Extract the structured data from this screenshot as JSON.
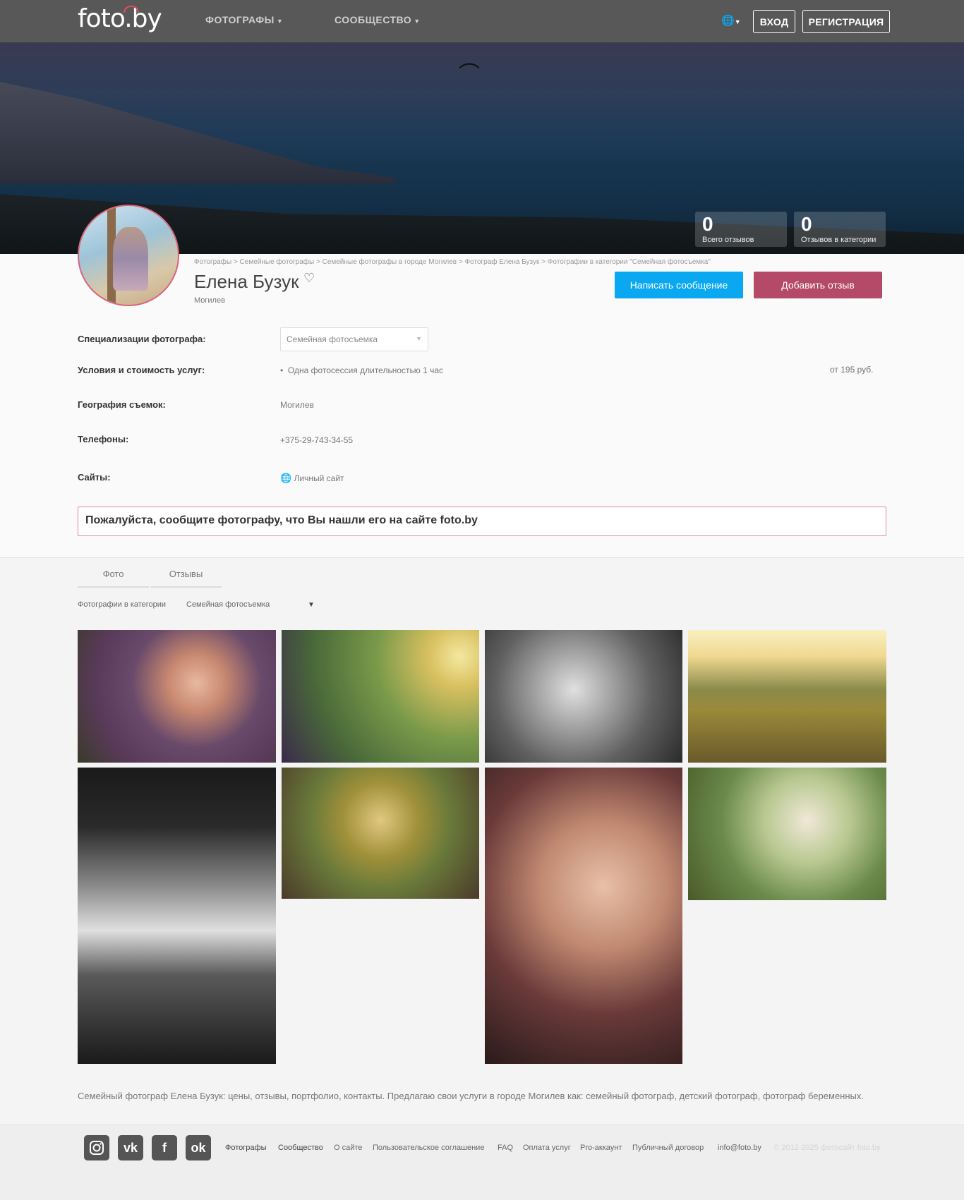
{
  "header": {
    "logo": "foto.by",
    "nav": [
      {
        "label": "ФОТОГРАФЫ"
      },
      {
        "label": "СООБЩЕСТВО"
      }
    ],
    "login_label": "ВХОД",
    "register_label": "РЕГИСТРАЦИЯ"
  },
  "stats": [
    {
      "value": "0",
      "label": "Всего отзывов"
    },
    {
      "value": "0",
      "label": "Отзывов в категории"
    }
  ],
  "profile": {
    "breadcrumb": "Фотографы > Семейные фотографы > Семейные фотографы в городе Могилев > Фотограф Елена Бузук > Фотографии в категории \"Семейная фотосъемка\"",
    "name": "Елена Бузук",
    "city": "Могилев",
    "message_button": "Написать сообщение",
    "review_button": "Добавить отзыв"
  },
  "details": {
    "spec_label": "Специализации фотографа:",
    "spec_value": "Семейная фотосъемка",
    "terms_label": "Условия и стоимость услуг:",
    "terms_item": "Одна фотосессия длительностью 1 час",
    "terms_price": "от 195 руб.",
    "geo_label": "География съемок:",
    "geo_value": "Могилев",
    "phones_label": "Телефоны:",
    "phones_value": "+375-29-743-34-55",
    "sites_label": "Сайты:",
    "sites_value": "Личный сайт"
  },
  "notice": "Пожалуйста, сообщите фотографу, что Вы нашли его на сайте foto.by",
  "tabs": [
    {
      "label": "Фото"
    },
    {
      "label": "Отзывы"
    }
  ],
  "category": {
    "label": "Фотографии в категории",
    "value": "Семейная фотосъемка"
  },
  "description": "Семейный фотограф Елена Бузук: цены, отзывы, портфолио, контакты. Предлагаю свои услуги в городе Могилев как: семейный фотограф, детский фотограф, фотограф беременных.",
  "footer": {
    "links": [
      "Фотографы",
      "Сообщество",
      "О сайте",
      "Пользовательское соглашение",
      "FAQ",
      "Оплата услуг",
      "Pro-аккаунт",
      "Публичный договор",
      "info@foto.by"
    ],
    "copyright": "© 2012-2025 фотосайт foto.by",
    "social": [
      "instagram-icon",
      "vk-icon",
      "facebook-icon",
      "odnoklassniki-icon"
    ]
  },
  "colors": {
    "primary_button": "#0aa8f0",
    "review_button": "#b44a68",
    "notice_border": "#e08b98"
  }
}
